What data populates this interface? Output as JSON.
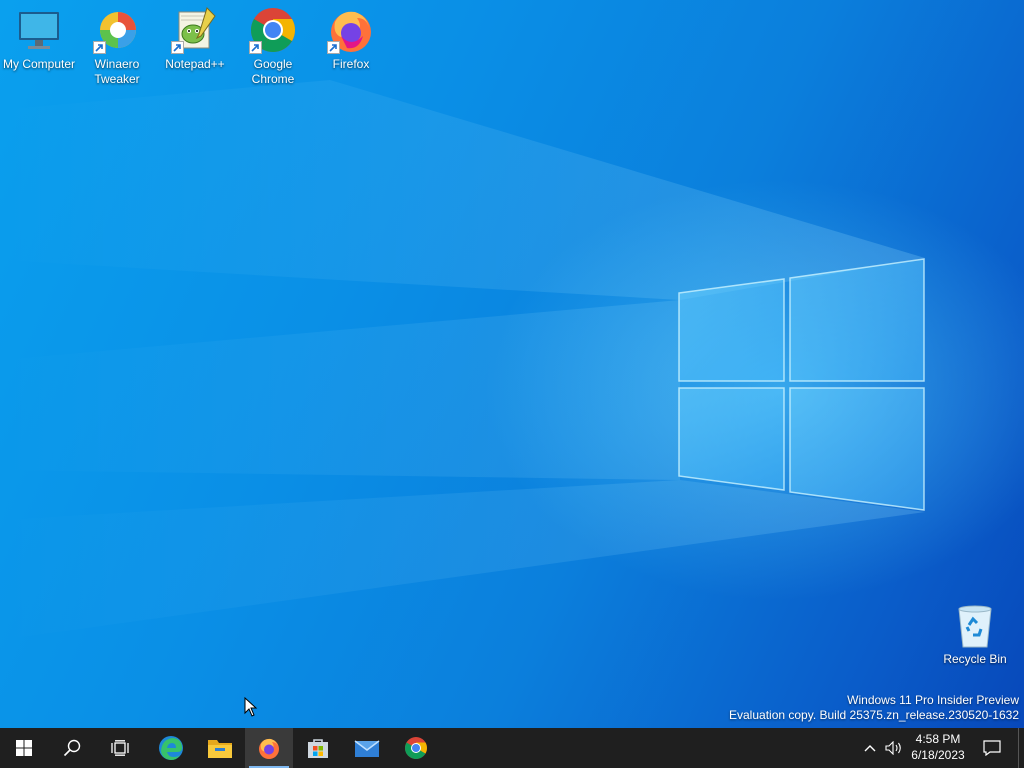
{
  "desktop": {
    "icons": [
      {
        "label": "My Computer",
        "icon": "monitor-icon"
      },
      {
        "label": "Winaero Tweaker",
        "icon": "winaero-tweaker-icon"
      },
      {
        "label": "Notepad++",
        "icon": "notepadpp-icon"
      },
      {
        "label": "Google Chrome",
        "icon": "chrome-icon"
      },
      {
        "label": "Firefox",
        "icon": "firefox-icon"
      }
    ],
    "recycle_bin": {
      "label": "Recycle Bin",
      "icon": "recycle-bin-icon"
    }
  },
  "watermark": {
    "line1": "Windows 11 Pro Insider Preview",
    "line2": "Evaluation copy. Build 25375.zn_release.230520-1632"
  },
  "taskbar": {
    "buttons": [
      {
        "name": "start",
        "icon": "windows-logo-icon"
      },
      {
        "name": "search",
        "icon": "search-icon"
      },
      {
        "name": "task-view",
        "icon": "task-view-icon"
      },
      {
        "name": "edge",
        "icon": "edge-icon"
      },
      {
        "name": "file-explorer",
        "icon": "folder-icon"
      },
      {
        "name": "firefox",
        "icon": "firefox-icon",
        "active": true
      },
      {
        "name": "microsoft-store",
        "icon": "store-icon"
      },
      {
        "name": "mail",
        "icon": "mail-icon"
      },
      {
        "name": "chrome",
        "icon": "chrome-icon"
      }
    ],
    "tray": {
      "chevron_icon": "chevron-up-icon",
      "volume_icon": "speaker-icon",
      "time": "4:58 PM",
      "date": "6/18/2023",
      "notification_icon": "action-center-icon"
    }
  },
  "colors": {
    "taskbar_bg": "#1f1f1f",
    "desktop_accent": "#0a8fe6"
  }
}
